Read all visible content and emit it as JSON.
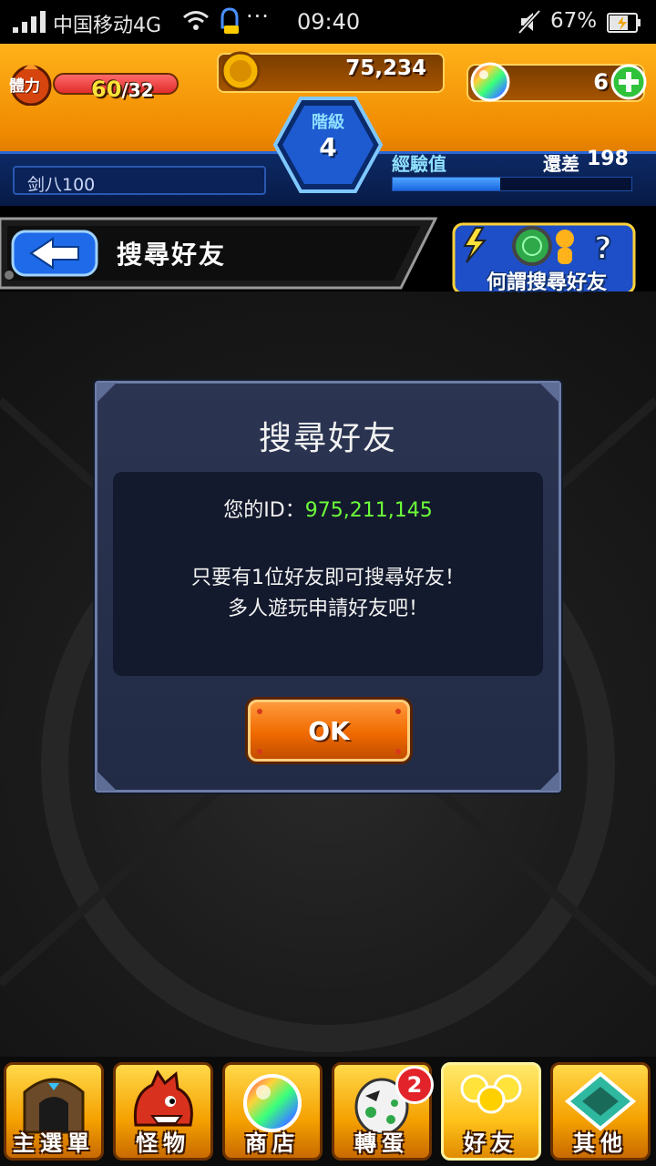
{
  "status_bar": {
    "carrier": "中国移动4G",
    "dots": "···",
    "time": "09:40",
    "battery_pct": "67%"
  },
  "hud": {
    "stamina_label": "體力",
    "stamina_current": "60",
    "stamina_max": "/32",
    "coins": "75,234",
    "orbs": "6",
    "rank_label": "階級",
    "rank_value": "4",
    "player_name": "剑八100",
    "exp_label": "經驗值",
    "exp_remain_label": "還差",
    "exp_remain_value": "198",
    "exp_progress": 0.45,
    "accent_orange": "#f08a00",
    "accent_blue": "#1a66e0"
  },
  "sub_header": {
    "title": "搜尋好友",
    "help_button": "何謂搜尋好友"
  },
  "dialog": {
    "title": "搜尋好友",
    "id_label": "您的ID：",
    "id_value": "975,211,145",
    "message_line1": "只要有1位好友即可搜尋好友！",
    "message_line2": "多人遊玩申請好友吧！",
    "ok_label": "OK"
  },
  "nav": {
    "items": [
      {
        "label": "主選單",
        "icon": "home-gate-icon"
      },
      {
        "label": "怪物",
        "icon": "monster-icon"
      },
      {
        "label": "商店",
        "icon": "rainbow-orb-icon"
      },
      {
        "label": "轉蛋",
        "icon": "egg-icon"
      },
      {
        "label": "好友",
        "icon": "friends-icon"
      },
      {
        "label": "其他",
        "icon": "other-icon"
      }
    ],
    "egg_badge": "2"
  }
}
